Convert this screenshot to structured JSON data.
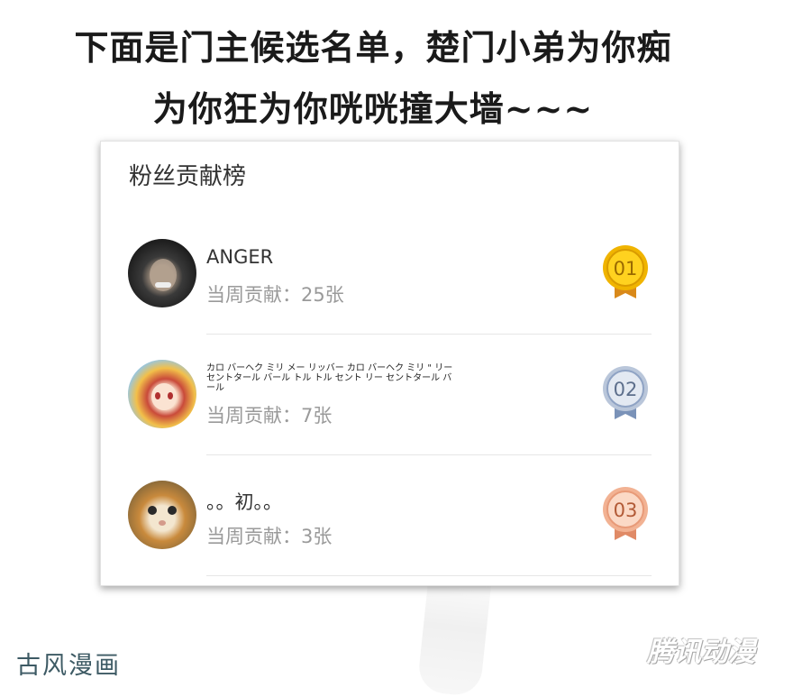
{
  "header": {
    "line1": "下面是门主候选名单，楚门小弟为你痴",
    "line2": "为你狂为你咣咣撞大墙~~~"
  },
  "leaderboard": {
    "title": "粉丝贡献榜",
    "entries": [
      {
        "rank": "01",
        "name": "ANGER",
        "contribution": "当周贡献：25张",
        "medal_color": "#f0b400"
      },
      {
        "rank": "02",
        "name": "カロ バーヘク ミリ メー リッバー カロ バーヘク ミリ \" リー セントタール バール トル トル セント リー セントタール バール",
        "contribution": "当周贡献：7张",
        "medal_color": "#8fa3c4"
      },
      {
        "rank": "03",
        "name": "。。初。。",
        "contribution": "当周贡献：3张",
        "medal_color": "#e89a78"
      }
    ]
  },
  "footer": {
    "left": "古风漫画",
    "right": "腾讯动漫"
  }
}
